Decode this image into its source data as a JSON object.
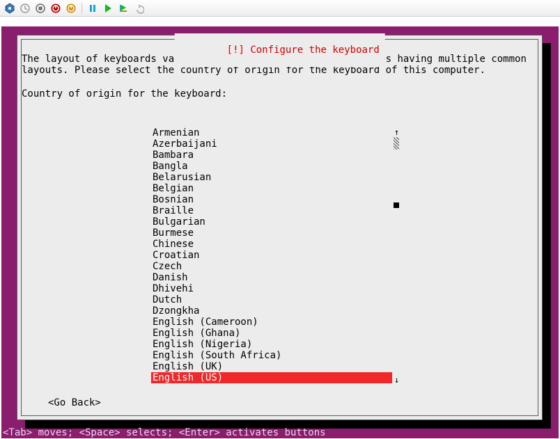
{
  "toolbar": {
    "icons": [
      "vm-logo",
      "clock",
      "stop",
      "shutdown",
      "power",
      "pause",
      "play",
      "step",
      "undo"
    ]
  },
  "dialog": {
    "title_prefix": "[!] ",
    "title": "Configure the keyboard",
    "paragraph": "The layout of keyboards varies per country, with some countries having multiple common layouts. Please select the country of origin for the keyboard of this computer.",
    "prompt": "Country of origin for the keyboard:",
    "go_back": "<Go Back>"
  },
  "list": {
    "items": [
      "Armenian",
      "Azerbaijani",
      "Bambara",
      "Bangla",
      "Belarusian",
      "Belgian",
      "Bosnian",
      "Braille",
      "Bulgarian",
      "Burmese",
      "Chinese",
      "Croatian",
      "Czech",
      "Danish",
      "Dhivehi",
      "Dutch",
      "Dzongkha",
      "English (Cameroon)",
      "English (Ghana)",
      "English (Nigeria)",
      "English (South Africa)",
      "English (UK)",
      "English (US)"
    ],
    "selected_index": 22
  },
  "hint": "<Tab> moves; <Space> selects; <Enter> activates buttons"
}
